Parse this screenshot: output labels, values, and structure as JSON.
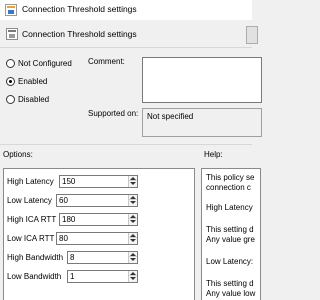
{
  "window": {
    "title": "Connection Threshold settings"
  },
  "header": {
    "title": "Connection Threshold settings"
  },
  "state": {
    "options": [
      "Not Configured",
      "Enabled",
      "Disabled"
    ],
    "selected": "Enabled"
  },
  "comment": {
    "label": "Comment:",
    "value": ""
  },
  "supported": {
    "label": "Supported on:",
    "value": "Not specified"
  },
  "sections": {
    "options": "Options:",
    "help": "Help:"
  },
  "settings": [
    {
      "label": "High Latency",
      "value": "150"
    },
    {
      "label": "Low Latency",
      "value": "60"
    },
    {
      "label": "High ICA RTT",
      "value": "180"
    },
    {
      "label": "Low ICA RTT",
      "value": "80"
    },
    {
      "label": "High Bandwidth",
      "value": "8"
    },
    {
      "label": "Low Bandwidth",
      "value": "1"
    }
  ],
  "help": {
    "lines": [
      "This policy se",
      "connection c",
      "High Latency",
      "This setting d",
      "Any value gre",
      "Low Latency:",
      "This setting d",
      "Any value low"
    ]
  }
}
